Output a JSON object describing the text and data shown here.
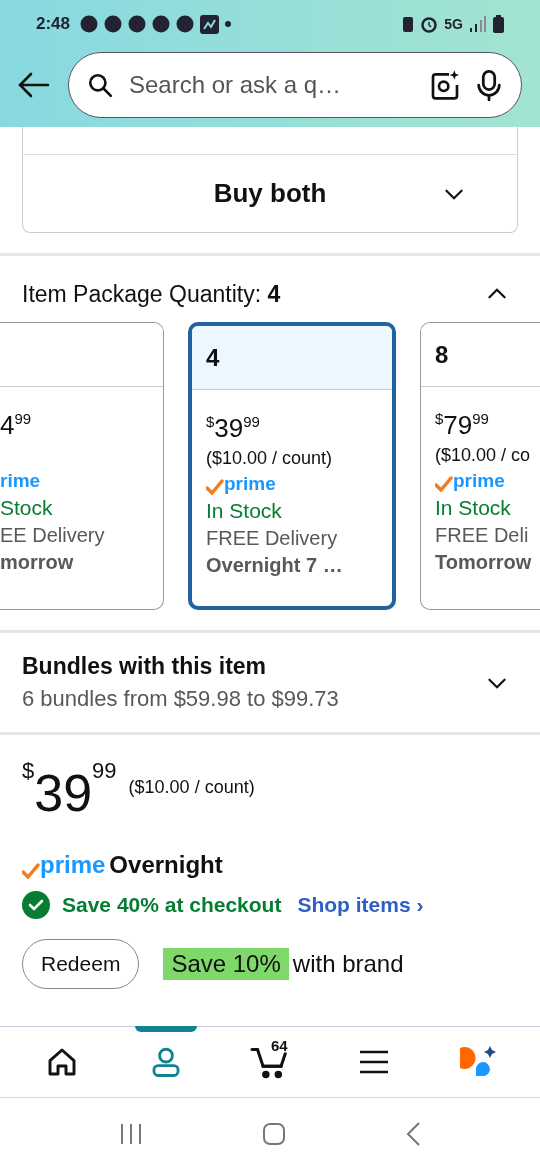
{
  "status_bar": {
    "time": "2:48",
    "network": "5G"
  },
  "search": {
    "placeholder": "Search or ask a q…"
  },
  "buy_both": {
    "label": "Buy both",
    "expanded": false
  },
  "quantity": {
    "label": "Item Package Quantity:",
    "value": "4",
    "expanded": true
  },
  "options": [
    {
      "kind": "cut-left",
      "selected": false,
      "price": {
        "whole": "4",
        "fraction": "99"
      },
      "prime": "rime",
      "stock": "Stock",
      "delivery": "EE Delivery",
      "date": "morrow"
    },
    {
      "kind": "full",
      "selected": true,
      "title": "4",
      "price": {
        "currency": "$",
        "whole": "39",
        "fraction": "99"
      },
      "unit": "($10.00 / count)",
      "prime": "prime",
      "stock": "In Stock",
      "delivery": "FREE Delivery",
      "date": "Overnight 7 …"
    },
    {
      "kind": "cut-right",
      "selected": false,
      "title": "8",
      "price": {
        "currency": "$",
        "whole": "79",
        "fraction": "99"
      },
      "unit": "($10.00 / co",
      "prime": "prime",
      "stock": "In Stock",
      "delivery": "FREE Deli",
      "date": "Tomorrow"
    }
  ],
  "bundles": {
    "title": "Bundles with this item",
    "subtitle": "6 bundles from $59.98 to $99.73",
    "expanded": false
  },
  "price": {
    "currency": "$",
    "whole": "39",
    "fraction": "99",
    "unit": "($10.00 / count)"
  },
  "prime_badge": {
    "logo": "prime",
    "speed": "Overnight"
  },
  "savings": {
    "text": "Save 40% at checkout",
    "link": "Shop items",
    "link_arrow": "›"
  },
  "coupon": {
    "button": "Redeem",
    "highlight": "Save 10%",
    "text": "with brand"
  },
  "bottom_nav": [
    {
      "kind": "home",
      "selected": false
    },
    {
      "kind": "account",
      "selected": true
    },
    {
      "kind": "cart",
      "selected": false,
      "badge": "64"
    },
    {
      "kind": "menu",
      "selected": false
    },
    {
      "kind": "assistant",
      "selected": false
    }
  ]
}
